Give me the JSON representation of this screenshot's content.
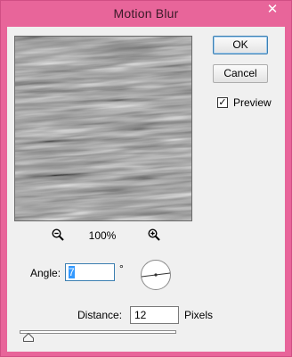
{
  "dialog": {
    "title": "Motion Blur",
    "close_glyph": "✕"
  },
  "buttons": {
    "ok_label": "OK",
    "cancel_label": "Cancel"
  },
  "preview": {
    "checkbox_label": "Preview",
    "checked": true,
    "check_glyph": "✓",
    "zoom_level": "100%",
    "zoom_out_icon": "zoom-out-icon",
    "zoom_in_icon": "zoom-in-icon"
  },
  "angle": {
    "label": "Angle:",
    "value": "7",
    "unit": "°"
  },
  "distance": {
    "label": "Distance:",
    "value": "12",
    "unit": "Pixels"
  },
  "colors": {
    "titlebar": "#e8659a",
    "client": "#f0f0f0",
    "selection": "#3399ff"
  }
}
